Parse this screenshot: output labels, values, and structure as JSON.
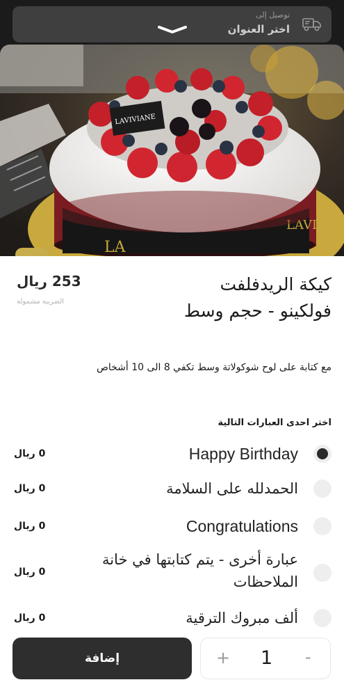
{
  "header": {
    "deliver_to_label": "توصيل إلى",
    "address_label": "اختر العنوان",
    "icons": [
      "truck-icon",
      "chevron-down-icon"
    ]
  },
  "product": {
    "image_logo_text": "LAVIVIANE",
    "title_line1": "كيكة الريدفلفت",
    "title_line2": "فولكينو -  حجم وسط",
    "price": "253 ريال",
    "tax_note": "الضريبة مشمولة",
    "description": "مع كتابة على لوح شوكولاتة وسط تكفي 8 الى 10 أشخاص"
  },
  "options": {
    "heading": "اختر احدى العبارات التالية",
    "items": [
      {
        "label": "Happy Birthday",
        "price": "0 ريال",
        "selected": true
      },
      {
        "label": "الحمدلله على السلامة",
        "price": "0 ريال",
        "selected": false
      },
      {
        "label": "Congratulations",
        "price": "0 ريال",
        "selected": false
      },
      {
        "label": "عبارة أخرى -  يتم كتابتها في خانة الملاحظات",
        "price": "0 ريال",
        "selected": false
      },
      {
        "label": "ألف مبروك الترقية",
        "price": "0 ريال",
        "selected": false
      }
    ]
  },
  "cart": {
    "add_label": "إضافة",
    "quantity": "1",
    "plus_symbol": "+",
    "minus_symbol": "-"
  },
  "colors": {
    "accent_gold": "#c7ad4d",
    "button_dark": "#2e2e2e",
    "topbar": "#3f3f3f"
  }
}
